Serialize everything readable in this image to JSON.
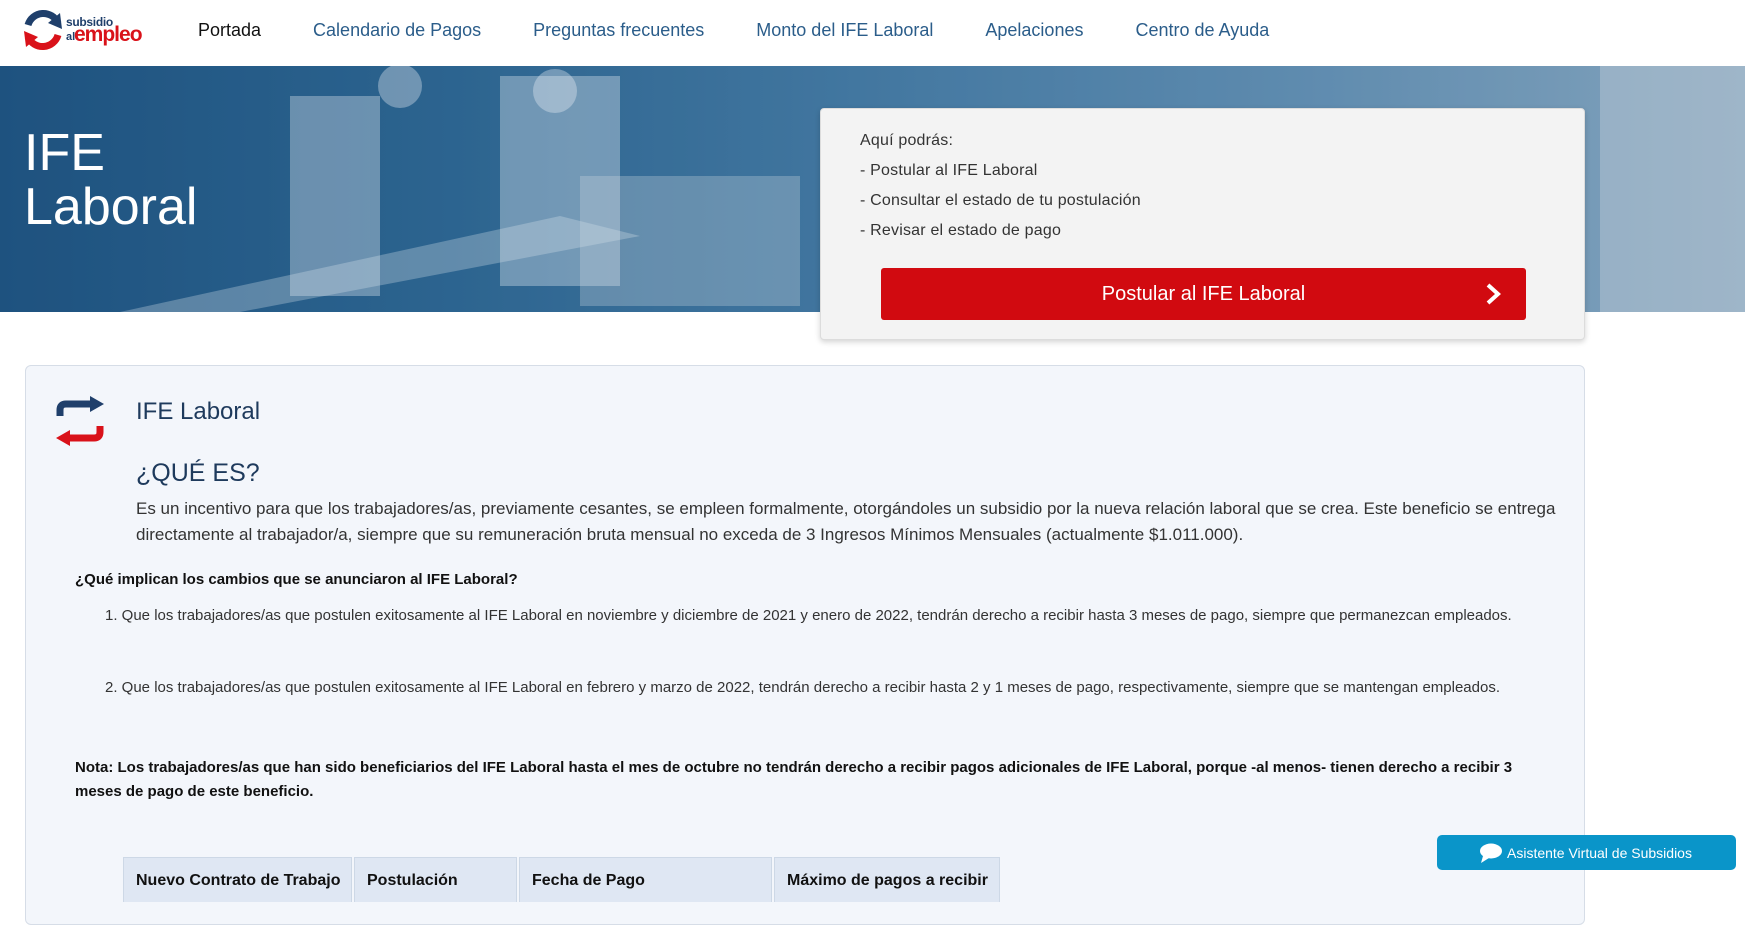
{
  "header": {
    "logo": {
      "line1": "subsidio",
      "line2": "al",
      "line3": "empleo"
    },
    "nav": [
      {
        "label": "Portada",
        "active": true
      },
      {
        "label": "Calendario de Pagos",
        "active": false
      },
      {
        "label": "Preguntas frecuentes",
        "active": false
      },
      {
        "label": "Monto del IFE Laboral",
        "active": false
      },
      {
        "label": "Apelaciones",
        "active": false
      },
      {
        "label": "Centro de Ayuda",
        "active": false
      }
    ]
  },
  "hero": {
    "title_line1": "IFE",
    "title_line2": "Laboral"
  },
  "info_card": {
    "lines": [
      "Aquí podrás:",
      "- Postular al IFE Laboral",
      "- Consultar el estado de tu postulación",
      "- Revisar el estado de pago"
    ],
    "button_label": "Postular al IFE Laboral"
  },
  "panel": {
    "title": "IFE Laboral",
    "que_es": "¿QUÉ ES?",
    "que_es_text": "Es un incentivo para que los trabajadores/as, previamente cesantes, se empleen formalmente, otorgándoles un subsidio por la nueva relación laboral que se crea. Este beneficio se entrega directamente al trabajador/a, siempre que su remuneración bruta mensual no exceda de 3 Ingresos Mínimos Mensuales (actualmente $1.011.000).",
    "question": "¿Qué implican los cambios que se anunciaron al IFE Laboral?",
    "items": [
      "1. Que los trabajadores/as que postulen exitosamente al IFE Laboral en noviembre y diciembre de 2021 y enero de 2022, tendrán derecho a recibir hasta 3 meses de pago, siempre que permanezcan empleados.",
      "2. Que los trabajadores/as que postulen exitosamente al IFE Laboral en febrero y marzo de 2022, tendrán derecho a recibir hasta 2 y 1 meses de pago, respectivamente, siempre que se mantengan empleados."
    ],
    "note": "Nota: Los trabajadores/as que han sido beneficiarios del IFE Laboral hasta el mes de octubre no tendrán derecho a recibir pagos adicionales de IFE Laboral, porque -al menos- tienen derecho a recibir 3 meses de pago de este beneficio.",
    "table_headers": [
      "Nuevo Contrato de Trabajo",
      "Postulación",
      "Fecha de Pago",
      "Máximo de pagos a recibir"
    ]
  },
  "chat": {
    "label": "Asistente Virtual de Subsidios"
  },
  "colors": {
    "brand_blue": "#1f3f6b",
    "brand_red": "#d10a10",
    "nav_link": "#2b5d8a",
    "chat_blue": "#0a95c9"
  }
}
